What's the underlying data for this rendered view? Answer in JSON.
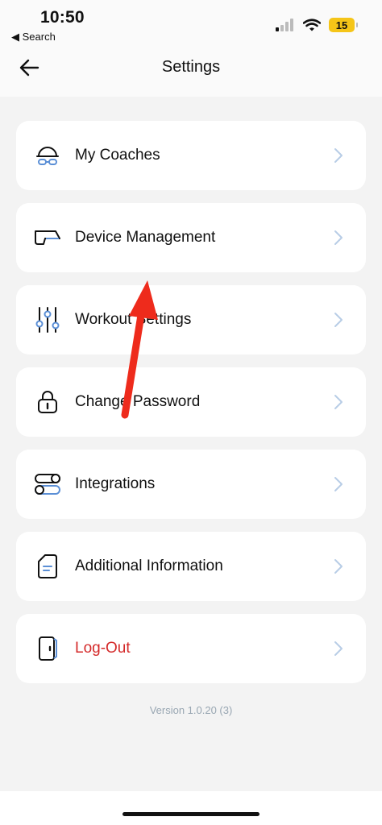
{
  "status_bar": {
    "time": "10:50",
    "back_app": "◀ Search",
    "battery": "15"
  },
  "header": {
    "title": "Settings"
  },
  "menu": [
    {
      "label": "My Coaches",
      "icon": "coach-icon"
    },
    {
      "label": "Device Management",
      "icon": "device-icon"
    },
    {
      "label": "Workout Settings",
      "icon": "sliders-icon"
    },
    {
      "label": "Change Password",
      "icon": "lock-icon"
    },
    {
      "label": "Integrations",
      "icon": "toggles-icon"
    },
    {
      "label": "Additional Information",
      "icon": "document-icon"
    },
    {
      "label": "Log-Out",
      "icon": "door-icon"
    }
  ],
  "version": "Version 1.0.20 (3)",
  "colors": {
    "accent": "#5b8fd6",
    "danger": "#d42a2a",
    "annotation_arrow": "#ee2b1c"
  }
}
